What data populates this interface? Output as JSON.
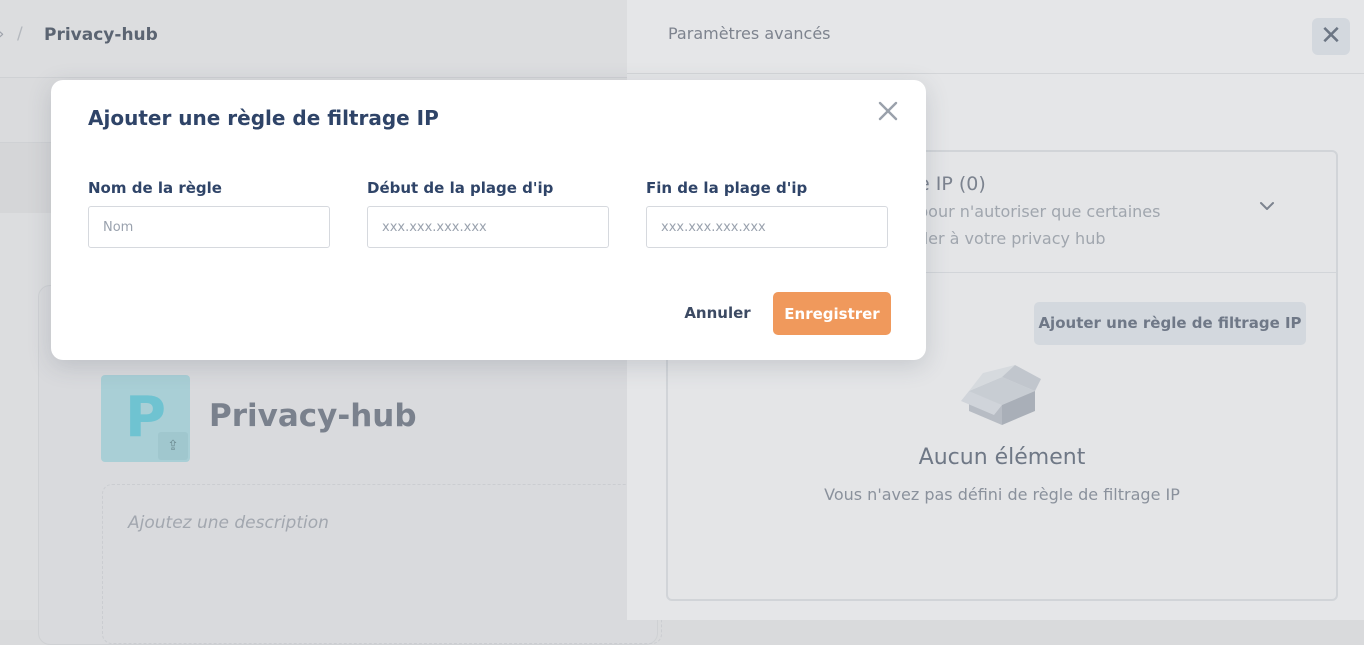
{
  "background": {
    "breadcrumb": {
      "parent": "›",
      "separator": "/",
      "current": "Privacy-hub"
    },
    "project": {
      "logo_letter": "P",
      "name": "Privacy-hub",
      "description_placeholder": "Ajoutez une description"
    }
  },
  "drawer": {
    "title": "Paramètres avancés",
    "section": {
      "title": "e IP (0)",
      "subtitle_line1": "pour n'autoriser que certaines",
      "subtitle_line2": "der à votre privacy hub"
    },
    "add_button_label": "Ajouter une règle de filtrage IP",
    "empty_state": {
      "title": "Aucun élément",
      "subtitle": "Vous n'avez pas défini de règle de filtrage IP"
    }
  },
  "modal": {
    "title": "Ajouter une règle de filtrage IP",
    "fields": [
      {
        "label": "Nom de la règle",
        "placeholder": "Nom",
        "value": ""
      },
      {
        "label": "Début de la plage d'ip",
        "placeholder": "xxx.xxx.xxx.xxx",
        "value": ""
      },
      {
        "label": "Fin de la plage d'ip",
        "placeholder": "xxx.xxx.xxx.xxx",
        "value": ""
      }
    ],
    "cancel_label": "Annuler",
    "save_label": "Enregistrer"
  },
  "colors": {
    "accent": "#f0995c",
    "heading": "#2f4468",
    "overlay": "#d9dadc"
  },
  "icons": {
    "modal_close": "close-icon",
    "drawer_close": "close-icon",
    "chevron": "chevron-down-icon",
    "empty": "empty-box-icon",
    "upload": "upload-icon"
  }
}
